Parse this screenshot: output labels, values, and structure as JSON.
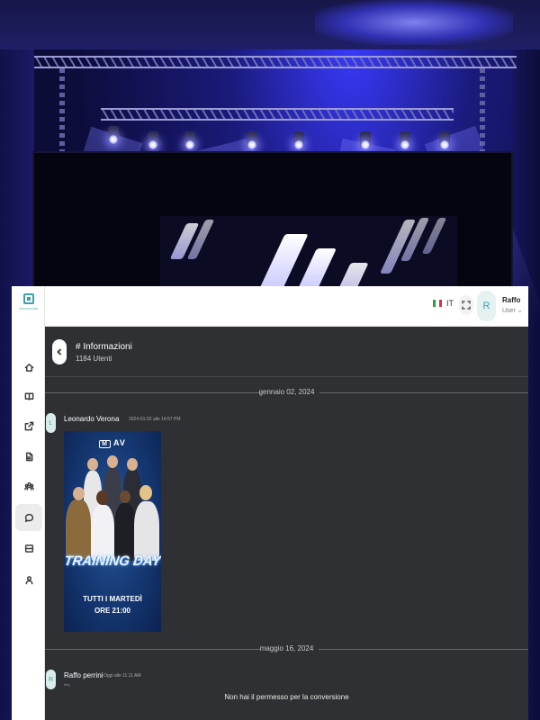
{
  "colors": {
    "accent": "#3aa1a8",
    "chat_background": "#2f3033",
    "sidebar_background": "#ffffff"
  },
  "sidebar": {
    "logo_text": "BRANDNAME",
    "items": [
      {
        "name": "home-icon"
      },
      {
        "name": "book-icon"
      },
      {
        "name": "external-link-icon"
      },
      {
        "name": "document-icon"
      },
      {
        "name": "group-icon"
      },
      {
        "name": "chat-icon",
        "active": true
      },
      {
        "name": "panels-icon"
      },
      {
        "name": "profile-icon"
      }
    ]
  },
  "header": {
    "language": "IT",
    "flag_icon": "italy-flag-icon",
    "fullscreen_icon": "fullscreen-icon",
    "avatar_initial": "R",
    "user_name": "Raffo",
    "user_role": "User ⌄"
  },
  "channel": {
    "back_icon": "chevron-left-icon",
    "title": "# Informazioni",
    "subtitle": "1184 Utenti"
  },
  "messages": [
    {
      "date_divider": "gennaio 02, 2024",
      "avatar_initial": "L",
      "author": "Leonardo Verona",
      "timestamp": "2024-01-02 alle 14:57 PM",
      "poster": {
        "logos": "M AV",
        "title": "TRAINING DAY",
        "line1": "TUTTI I MARTEDÌ",
        "line2": "ORE 21:00"
      }
    },
    {
      "date_divider": "maggio 16, 2024",
      "avatar_initial": "R",
      "author": "Raffo perrini",
      "timestamp": "Oggi alle 11:11 AM",
      "text": "hey"
    }
  ],
  "notice": "Non hai il permesso per la conversione"
}
